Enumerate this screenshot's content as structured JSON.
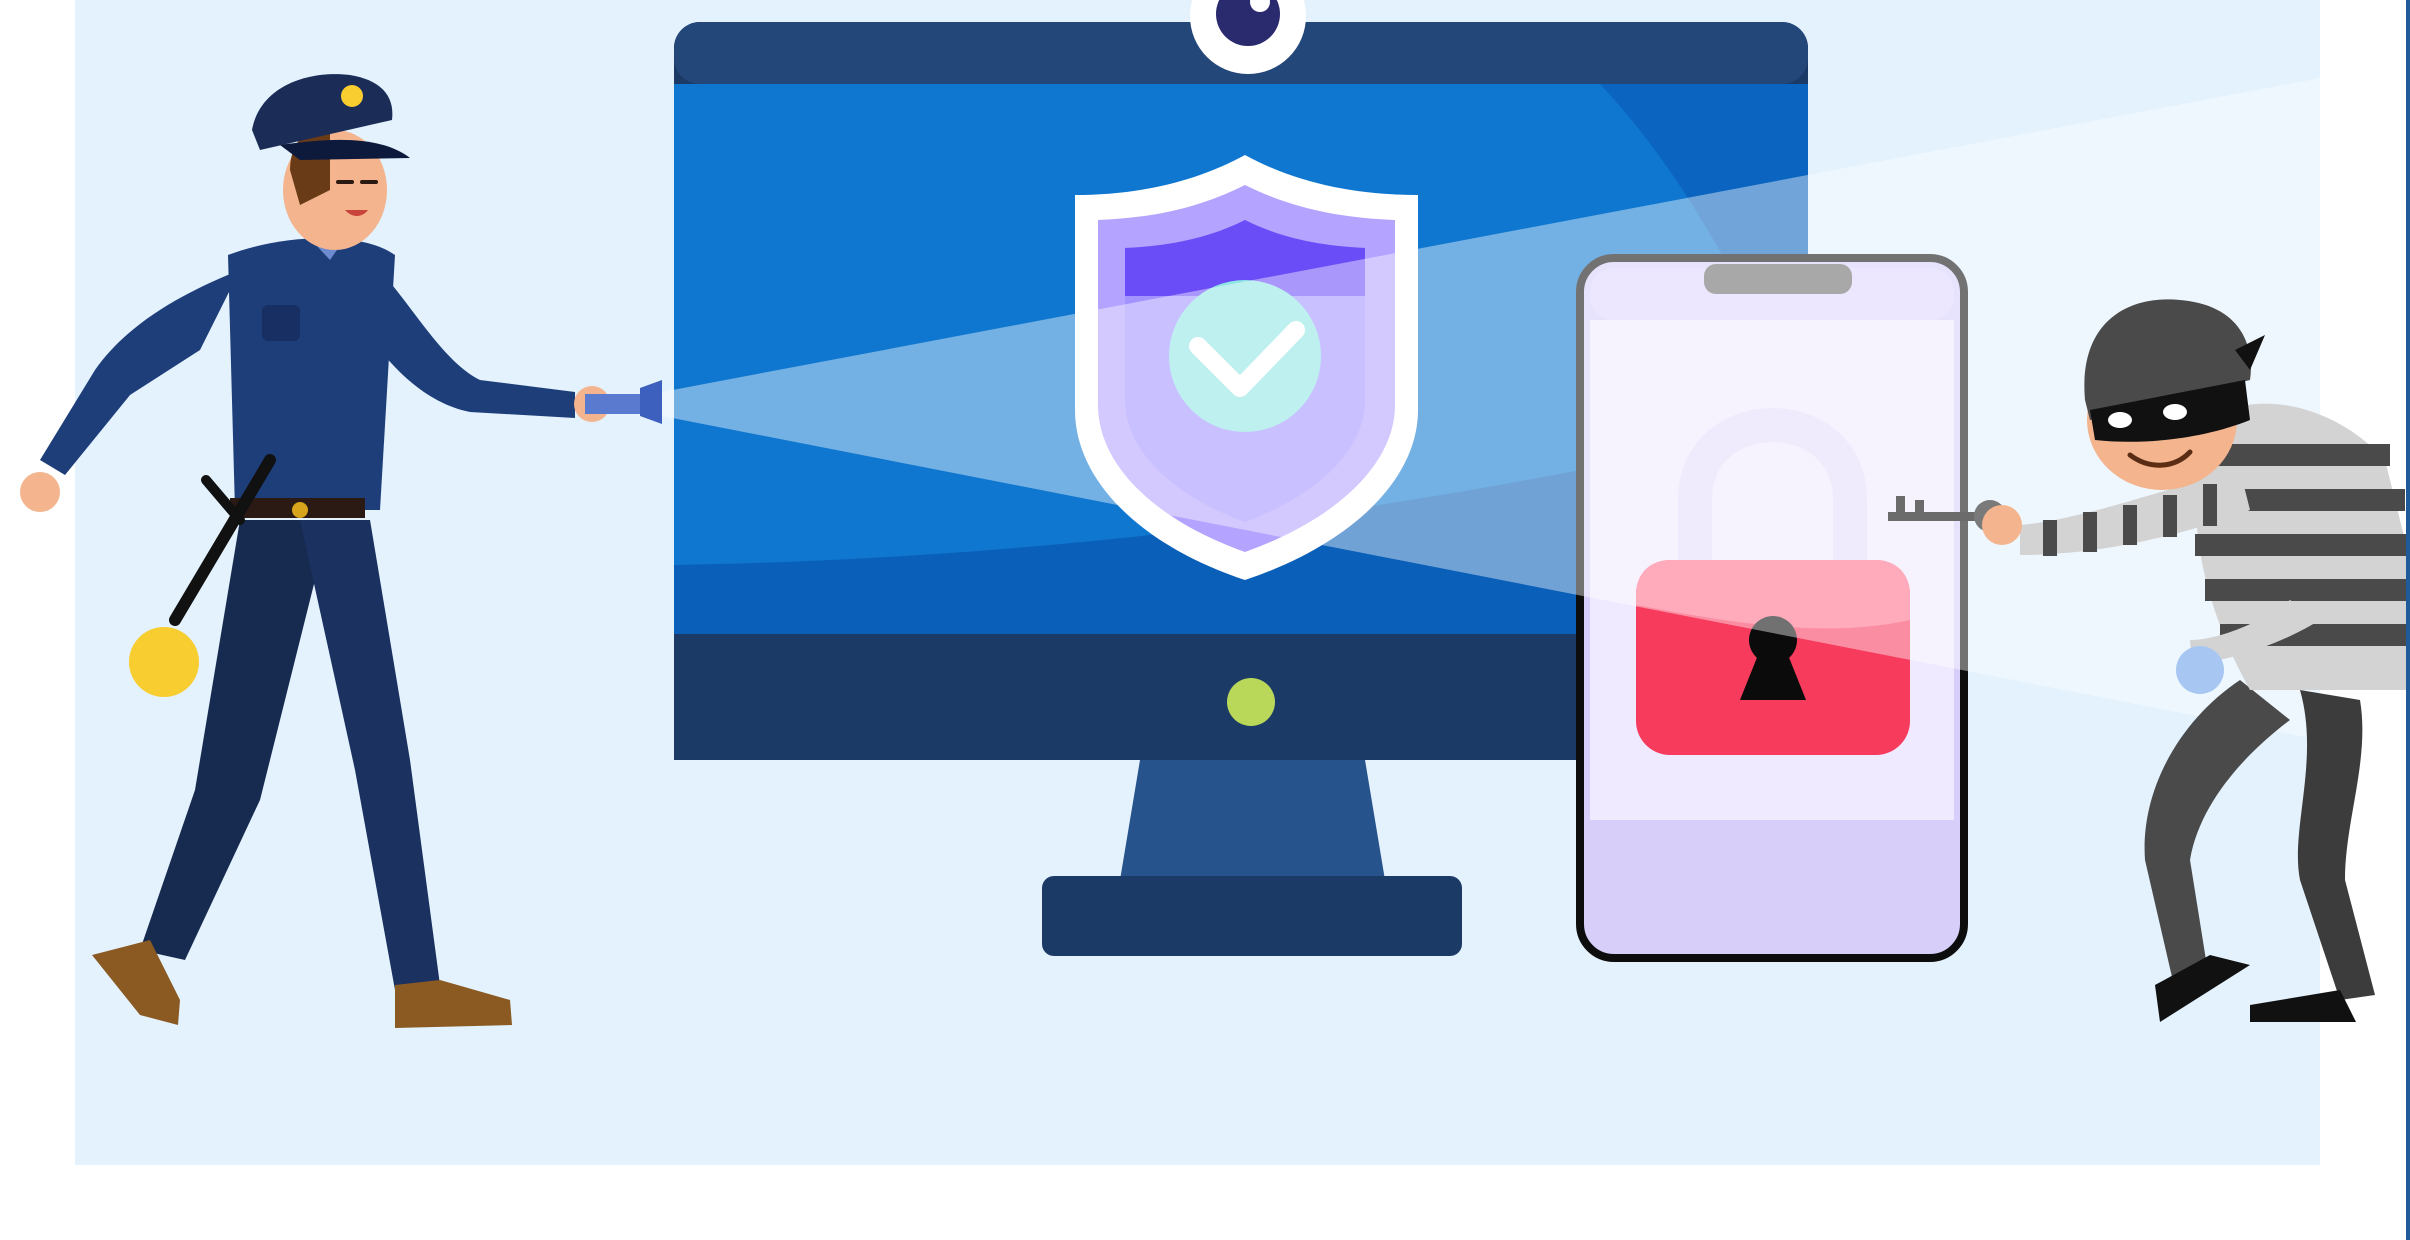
{
  "illustration": {
    "subject": "",
    "colors": {
      "page_background": "#ffffff",
      "scene_background": "#e3f2fd",
      "monitor_frame": "#1c3a66",
      "monitor_screen": "#0f77cf",
      "shield_accent": "#6b4df8",
      "check_circle": "#8fe6e4",
      "lock_body": "#f73b5d",
      "phone_screen": "#efeaff",
      "police_uniform": "#1e3e7a",
      "thief_stripes": "#4a4a4a",
      "flashlight_beam": "#ffffff",
      "monitor_button": "#b9d85a",
      "badge_gold": "#f7cd2f",
      "right_edge_line": "#1f5a9a"
    },
    "icons": [
      "police-officer-icon",
      "flashlight-icon",
      "computer-monitor-icon",
      "webcam-icon",
      "security-shield-icon",
      "check-mark-icon",
      "smartphone-icon",
      "padlock-icon",
      "key-icon",
      "burglar-icon"
    ]
  }
}
